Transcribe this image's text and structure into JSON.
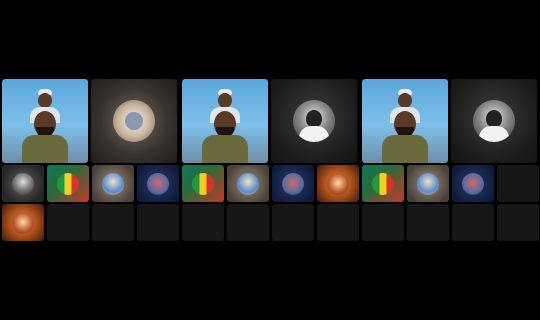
{
  "panels": [
    {
      "main_tile": {
        "label": "",
        "kind": "video-call"
      },
      "side_tile": {
        "kind": "avatar-photo"
      },
      "thumbnails": [
        "mono",
        "flag",
        "sand",
        "navy",
        "amber",
        "empty",
        "empty",
        "empty"
      ]
    },
    {
      "main_tile": {
        "label": "",
        "kind": "video-call"
      },
      "side_tile": {
        "kind": "avatar-mono"
      },
      "thumbnails": [
        "flag",
        "sand",
        "navy",
        "amber",
        "empty",
        "empty",
        "empty",
        "empty"
      ]
    },
    {
      "main_tile": {
        "label": "",
        "kind": "video-call"
      },
      "side_tile": {
        "kind": "avatar-mono"
      },
      "thumbnails": [
        "flag",
        "sand",
        "navy",
        "empty",
        "empty",
        "empty",
        "empty",
        "empty"
      ]
    }
  ],
  "colors": {
    "background": "#000000",
    "video_sky": "#7ec0ea",
    "empty_tile": "#171717"
  }
}
